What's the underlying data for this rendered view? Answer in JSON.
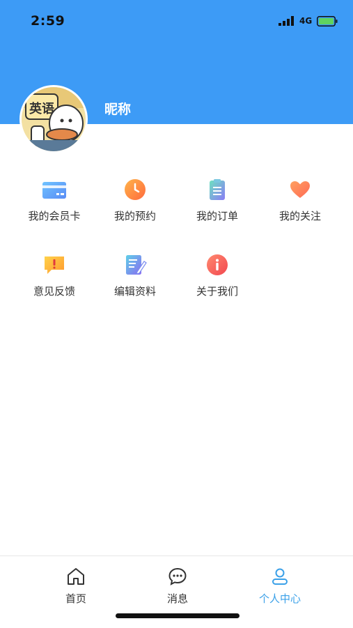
{
  "status_bar": {
    "time": "2:59",
    "network": "4G"
  },
  "profile": {
    "nickname": "昵称",
    "avatar_text": "英语"
  },
  "menu": [
    {
      "label": "我的会员卡",
      "icon": "member-card-icon"
    },
    {
      "label": "我的预约",
      "icon": "clock-icon"
    },
    {
      "label": "我的订单",
      "icon": "clipboard-icon"
    },
    {
      "label": "我的关注",
      "icon": "heart-icon"
    },
    {
      "label": "意见反馈",
      "icon": "feedback-icon"
    },
    {
      "label": "编辑资料",
      "icon": "edit-icon"
    },
    {
      "label": "关于我们",
      "icon": "info-icon"
    }
  ],
  "tabs": [
    {
      "label": "首页",
      "icon": "home-icon",
      "active": false
    },
    {
      "label": "消息",
      "icon": "message-icon",
      "active": false
    },
    {
      "label": "个人中心",
      "icon": "user-icon",
      "active": true
    }
  ],
  "colors": {
    "header": "#3d9bf6",
    "active_tab": "#3aa0e8"
  }
}
